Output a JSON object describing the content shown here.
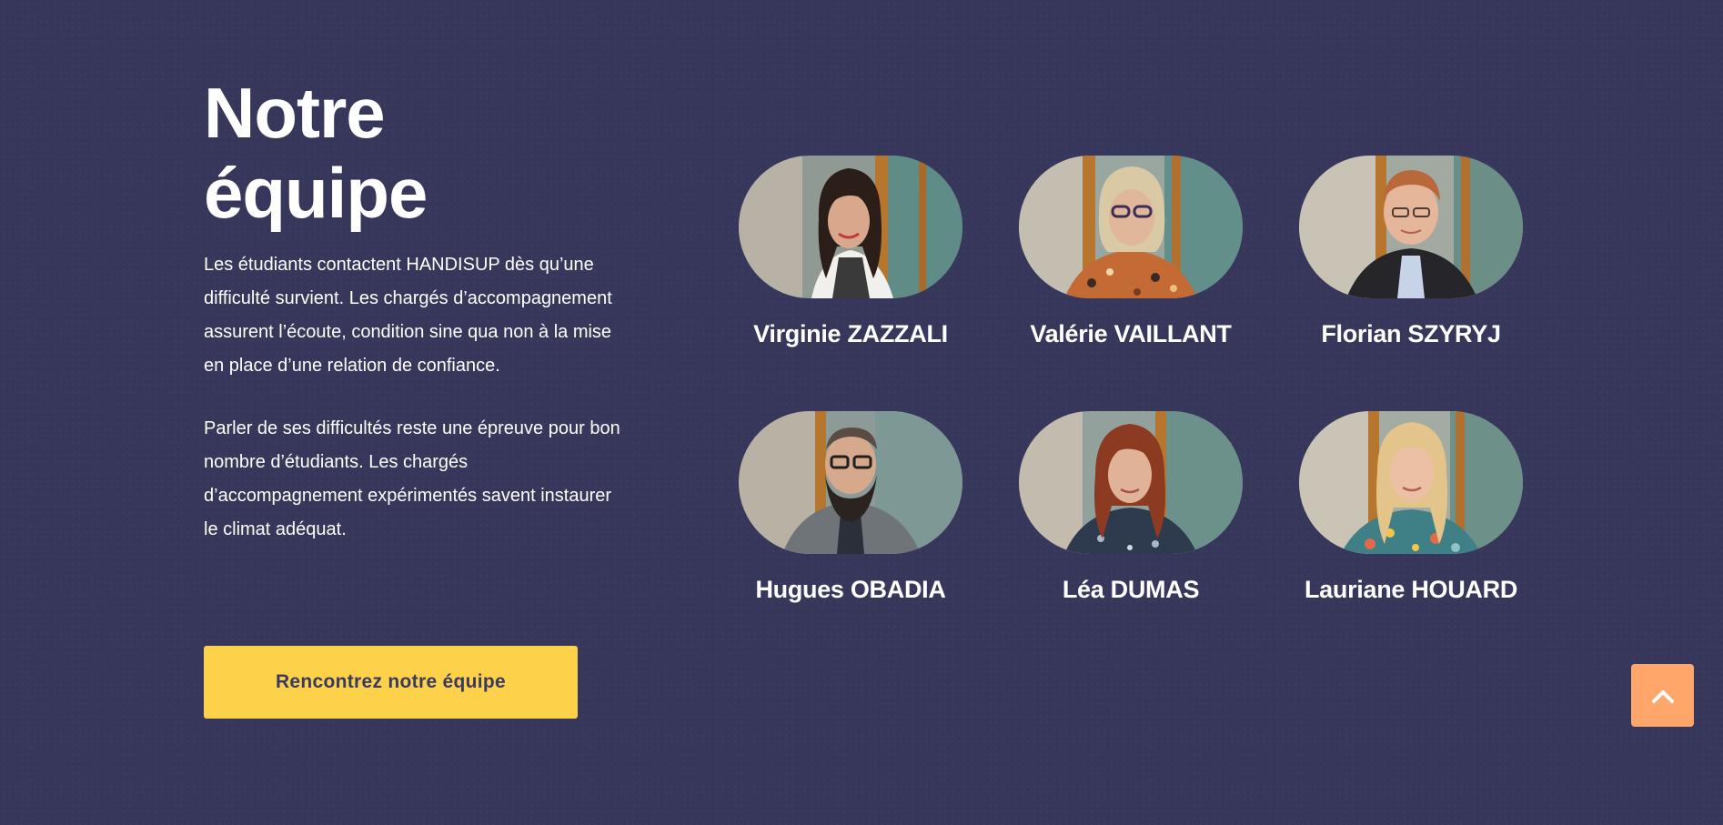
{
  "section": {
    "title": "Notre\néquipe",
    "paragraphs": [
      "Les étudiants contactent HANDISUP dès qu’une difficulté survient. Les chargés d’accompagnement assurent l’écoute, condition sine qua non à la mise en place d’une relation de confiance.",
      "Parler de ses difficultés reste une épreuve pour bon nombre d’étudiants. Les chargés d’accompagnement expérimentés savent instaurer le climat adéquat."
    ],
    "cta_label": "Rencontrez notre équipe"
  },
  "team": [
    {
      "name": "Virginie ZAZZALI"
    },
    {
      "name": "Valérie VAILLANT"
    },
    {
      "name": "Florian SZYRYJ"
    },
    {
      "name": "Hugues OBADIA"
    },
    {
      "name": "Léa DUMAS"
    },
    {
      "name": "Lauriane HOUARD"
    }
  ],
  "scroll_top": {
    "icon": "chevron-up-icon"
  },
  "colors": {
    "background": "#37375c",
    "cta_background": "#fdd24a",
    "cta_text": "#3a3960",
    "scroll_top_background": "#ffa76a"
  }
}
